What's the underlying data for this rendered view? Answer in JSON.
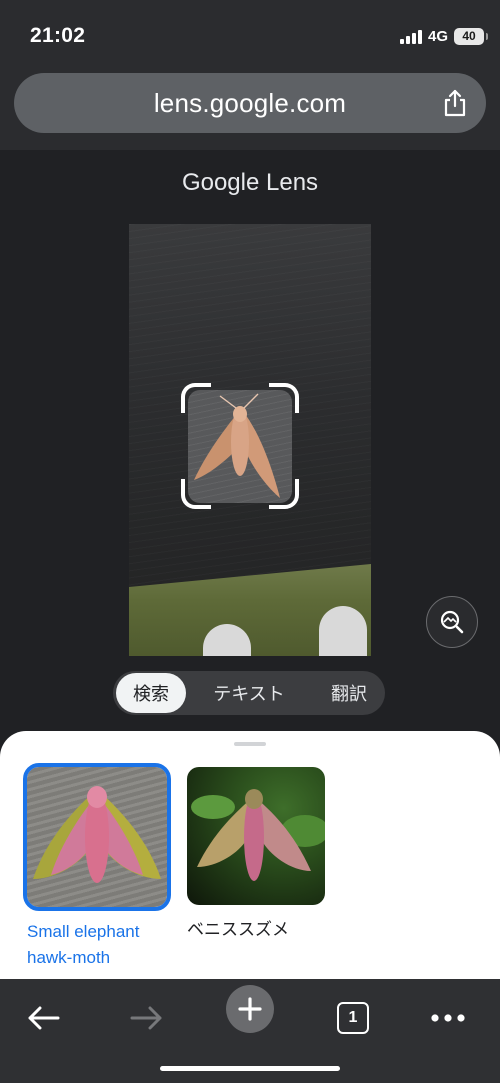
{
  "status_bar": {
    "time": "21:02",
    "network": "4G",
    "battery": "40"
  },
  "browser": {
    "url": "lens.google.com",
    "share_icon": "share-icon"
  },
  "lens": {
    "title": "Google Lens",
    "modes": [
      {
        "label": "検索",
        "active": true
      },
      {
        "label": "テキスト",
        "active": false
      },
      {
        "label": "翻訳",
        "active": false
      }
    ],
    "visual_search_icon": "image-search-icon"
  },
  "results": [
    {
      "label_line1": "Small elephant",
      "label_line2": "hawk-moth",
      "selected": true
    },
    {
      "label_line1": "ベニススズメ",
      "label_line2": "",
      "selected": false
    }
  ],
  "toolbar": {
    "back_icon": "arrow-left-icon",
    "forward_icon": "arrow-right-icon",
    "new_tab_icon": "plus-icon",
    "tab_count": "1",
    "menu_icon": "more-horizontal-icon"
  },
  "colors": {
    "accent": "#1a73e8",
    "background": "#202124",
    "sheet": "#ffffff"
  }
}
